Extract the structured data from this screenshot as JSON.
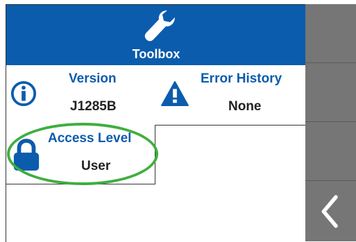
{
  "header": {
    "title": "Toolbox",
    "icon": "wrench-icon"
  },
  "tiles": {
    "version": {
      "label": "Version",
      "value": "J1285B",
      "icon": "info-icon"
    },
    "error_history": {
      "label": "Error History",
      "value": "None",
      "icon": "warning-icon"
    },
    "access_level": {
      "label": "Access Level",
      "value": "User",
      "icon": "lock-icon"
    }
  },
  "sidebar": {
    "back_icon": "chevron-left-icon"
  },
  "colors": {
    "accent": "#0b5cad",
    "sidebar": "#767676",
    "highlight": "#3fae3f"
  }
}
